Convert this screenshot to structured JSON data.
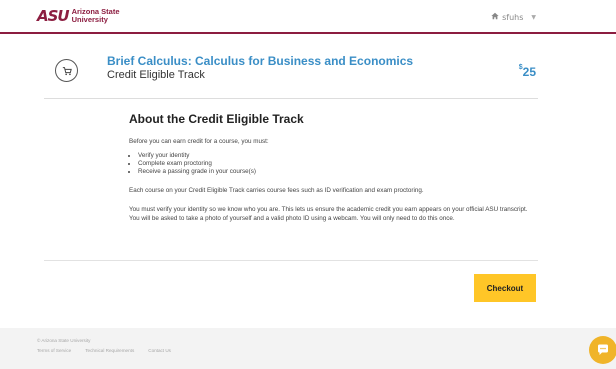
{
  "header": {
    "logo_mark": "ASU",
    "logo_line1": "Arizona State",
    "logo_line2": "University",
    "username": "sfuhs"
  },
  "course": {
    "title": "Brief Calculus: Calculus for Business and Economics",
    "subtitle": "Credit Eligible Track",
    "price_currency": "$",
    "price_value": "25"
  },
  "about": {
    "heading": "About the Credit Eligible Track",
    "intro": "Before you can earn credit for a course, you must:",
    "requirements": [
      "Verify your identity",
      "Complete exam proctoring",
      "Receive a passing grade in your course(s)"
    ],
    "fees": "Each course on your Credit Eligible Track carries course fees such as ID verification and exam proctoring.",
    "verify": "You must verify your identity so we know who you are. This lets us ensure the academic credit you earn appears on your official ASU transcript. You will be asked to take a photo of yourself and a valid photo ID using a webcam. You will only need to do this once."
  },
  "actions": {
    "checkout_label": "Checkout"
  },
  "footer": {
    "copyright": "© Arizona State University",
    "links": [
      "Terms of Service",
      "Technical Requirements",
      "Contact Us"
    ]
  },
  "colors": {
    "asu_maroon": "#8c1d40",
    "asu_gold": "#ffc627",
    "link_blue": "#3a8ec6"
  },
  "icons": {
    "cart": "shopping-cart-icon",
    "home": "home-icon",
    "chat": "chat-icon"
  }
}
